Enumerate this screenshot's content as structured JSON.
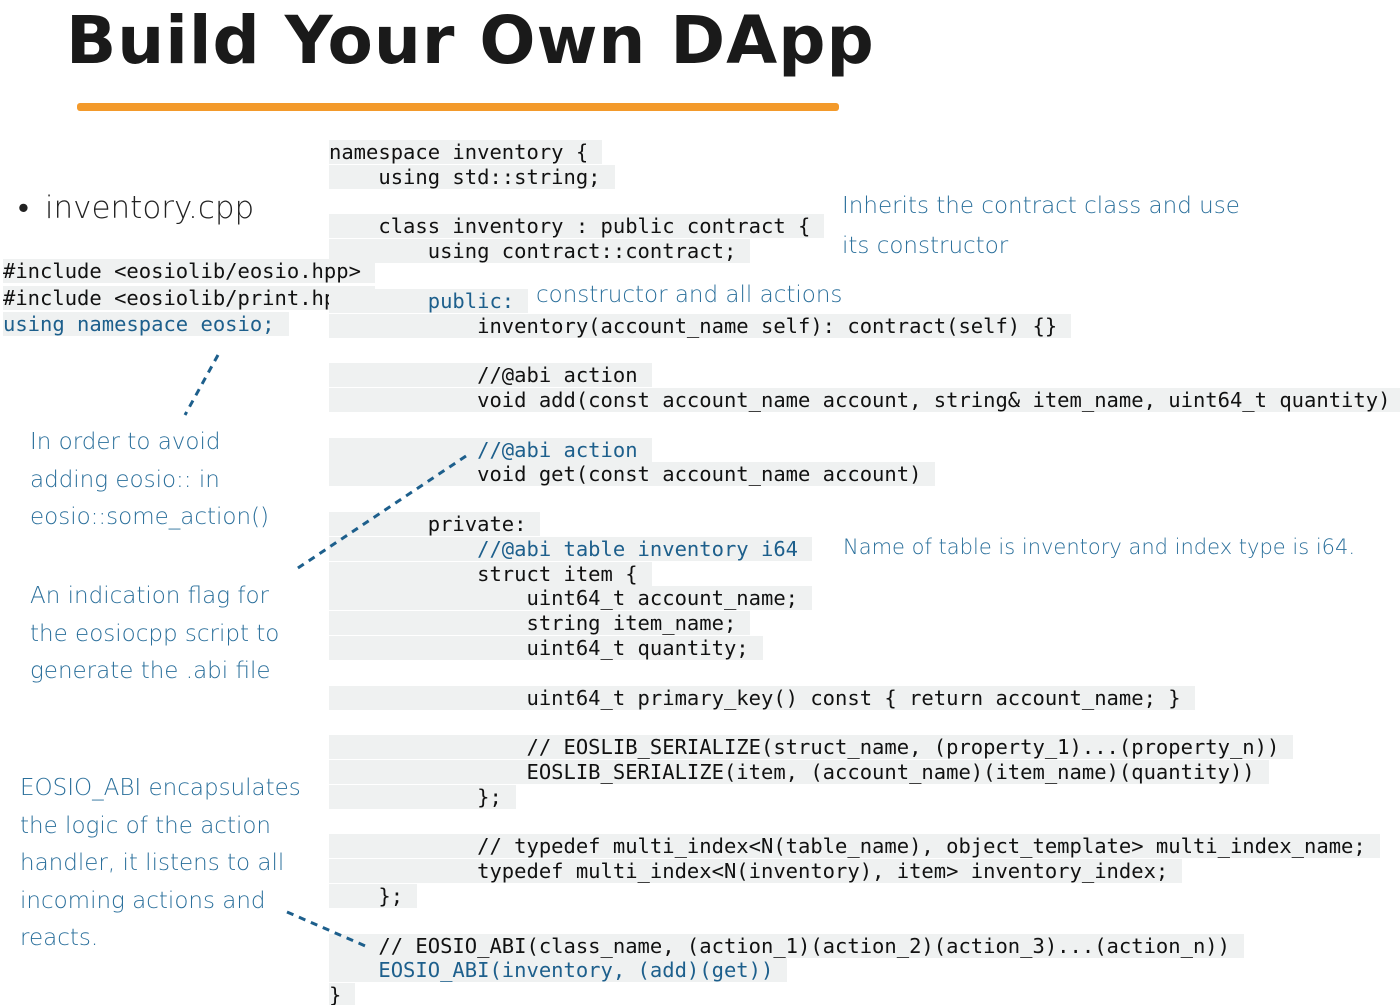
{
  "title": "Build Your Own DApp",
  "bullet": "inventory.cpp",
  "includes": [
    {
      "text": "#include <eosiolib/eosio.hpp>",
      "blue": false
    },
    {
      "text": "#include <eosiolib/print.hpp>",
      "blue": false
    },
    {
      "text": "using namespace eosio;",
      "blue": true
    }
  ],
  "code": [
    {
      "text": "namespace inventory {"
    },
    {
      "text": "    using std::string;"
    },
    {
      "text": ""
    },
    {
      "text": "    class inventory : public contract {"
    },
    {
      "text": "        using contract::contract;"
    },
    {
      "text": ""
    },
    {
      "text": "        public:",
      "blue": true
    },
    {
      "text": "            inventory(account_name self): contract(self) {}"
    },
    {
      "text": ""
    },
    {
      "text": "            //@abi action"
    },
    {
      "text": "            void add(const account_name account, string& item_name, uint64_t quantity)"
    },
    {
      "text": ""
    },
    {
      "text": "            //@abi action",
      "blue": true
    },
    {
      "text": "            void get(const account_name account)"
    },
    {
      "text": ""
    },
    {
      "text": "        private:"
    },
    {
      "text": "            //@abi table inventory i64",
      "blue": true
    },
    {
      "text": "            struct item {"
    },
    {
      "text": "                uint64_t account_name;"
    },
    {
      "text": "                string item_name;"
    },
    {
      "text": "                uint64_t quantity;"
    },
    {
      "text": ""
    },
    {
      "text": "                uint64_t primary_key() const { return account_name; }"
    },
    {
      "text": ""
    },
    {
      "text": "                // EOSLIB_SERIALIZE(struct_name, (property_1)...(property_n))"
    },
    {
      "text": "                EOSLIB_SERIALIZE(item, (account_name)(item_name)(quantity))"
    },
    {
      "text": "            };"
    },
    {
      "text": ""
    },
    {
      "text": "            // typedef multi_index<N(table_name), object_template> multi_index_name;"
    },
    {
      "text": "            typedef multi_index<N(inventory), item> inventory_index;"
    },
    {
      "text": "    };"
    },
    {
      "text": ""
    },
    {
      "text": "    // EOSIO_ABI(class_name, (action_1)(action_2)(action_3)...(action_n))"
    },
    {
      "text": "    EOSIO_ABI(inventory, (add)(get))",
      "blue": true
    },
    {
      "text": "}"
    }
  ],
  "notes": {
    "inherits": "Inherits the contract class and use\nits constructor",
    "constructor": "constructor and all actions",
    "avoid": "In order to avoid\nadding eosio:: in\neosio::some_action()",
    "flag": "An indication flag for\nthe eosiocpp script to\ngenerate the .abi file",
    "table": "Name of table is inventory and index type is i64.",
    "abi": "EOSIO_ABI encapsulates\nthe logic of the action\nhandler, it listens to all\nincoming actions and\nreacts."
  }
}
